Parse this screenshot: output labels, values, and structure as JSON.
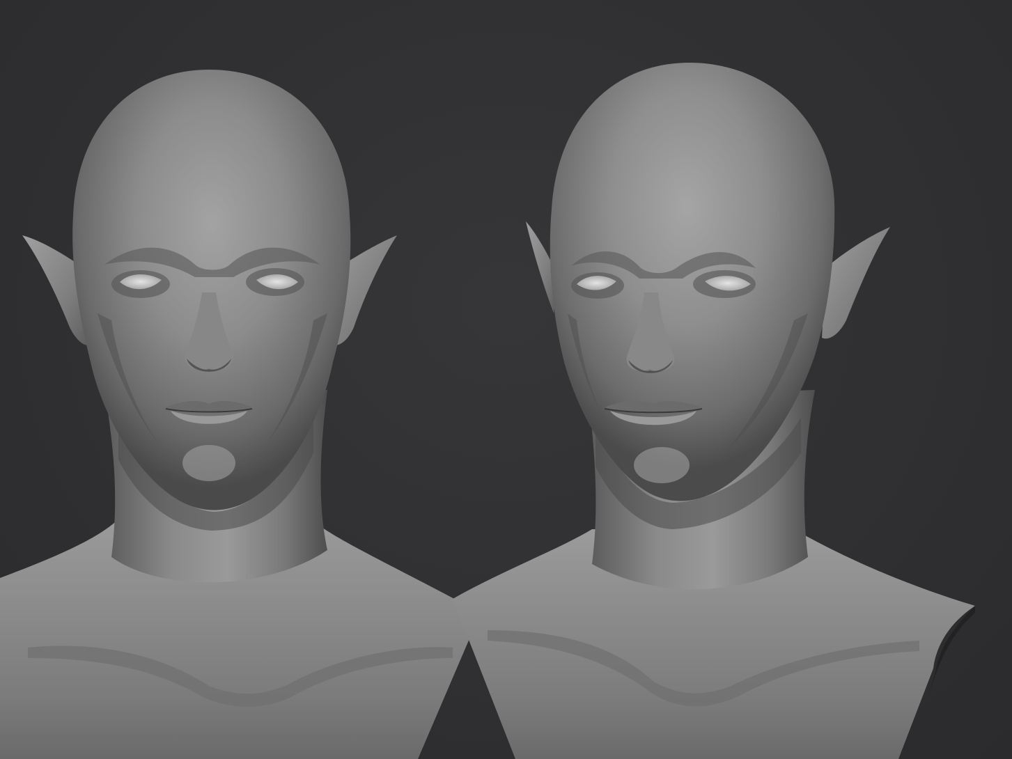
{
  "scene": {
    "background_color": "#303032",
    "material_color": "#8f8f8f",
    "views": [
      {
        "name": "front-view",
        "description_icon": "bust-front"
      },
      {
        "name": "three-quarter-view",
        "description_icon": "bust-three-quarter"
      }
    ]
  }
}
